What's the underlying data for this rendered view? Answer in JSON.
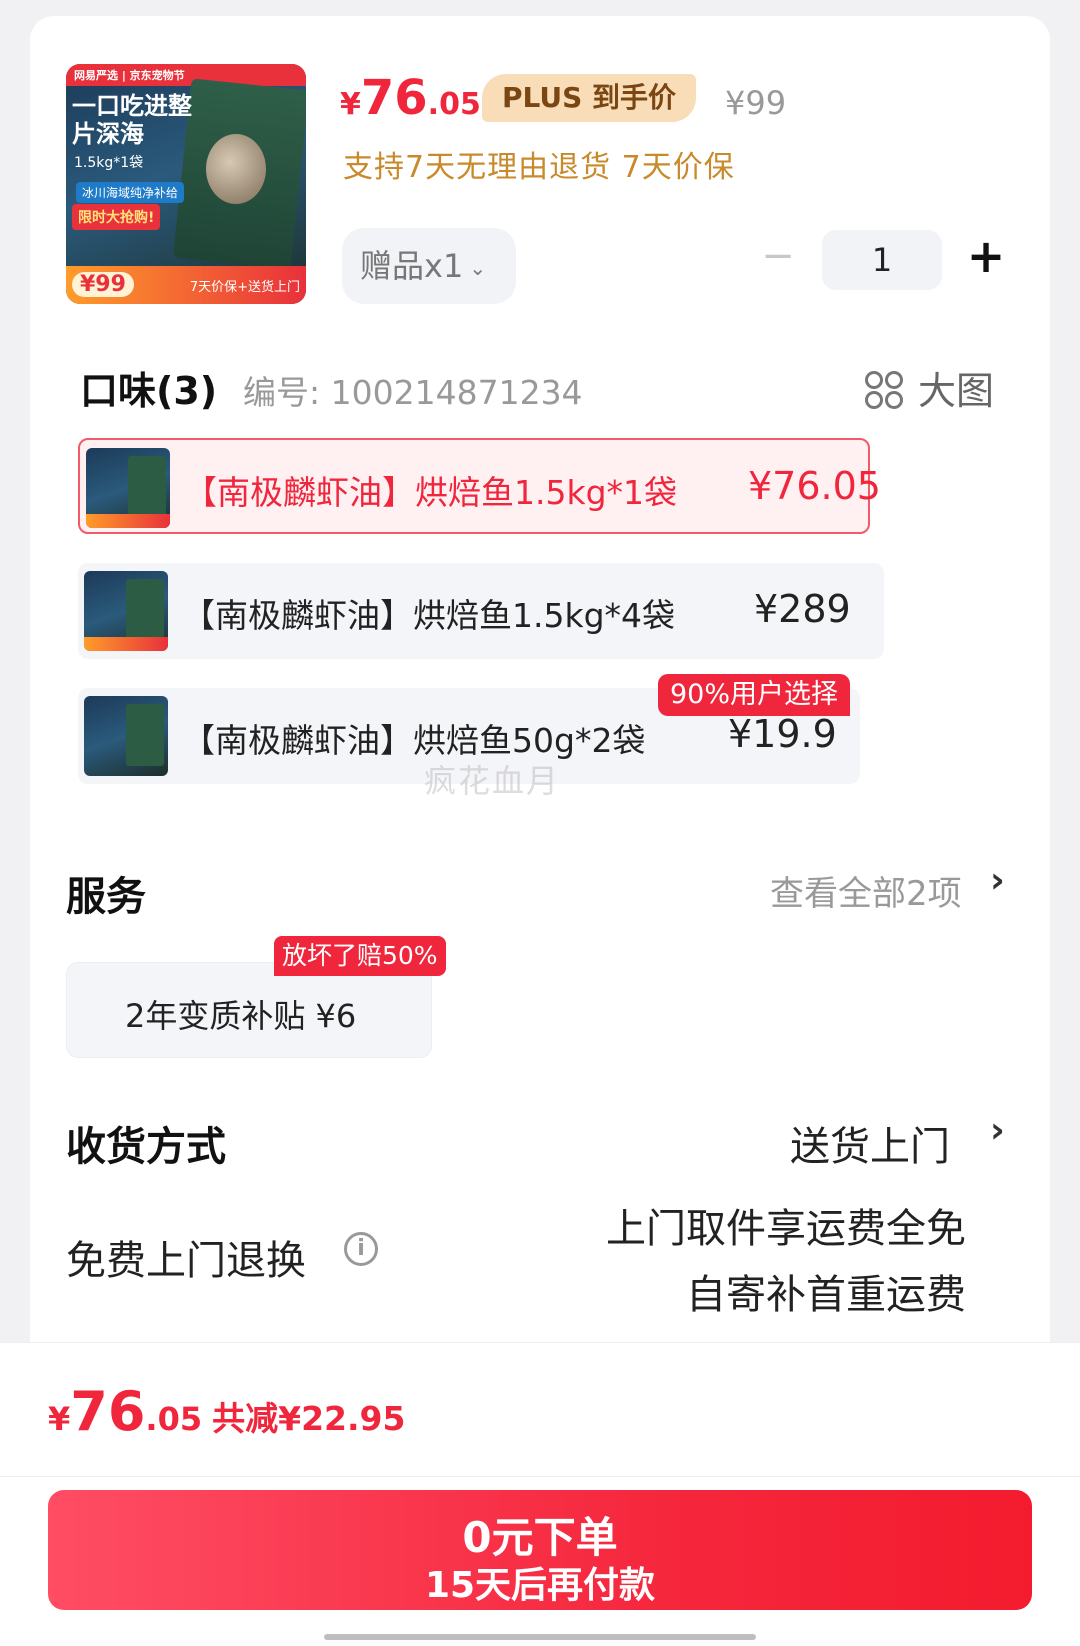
{
  "product": {
    "thumb": {
      "brand_bar": "网易严选 | 京东宠物节",
      "headline": "一口吃进整片深海",
      "spec": "1.5kg*1袋",
      "ribbon": "冰川海域纯净补给",
      "promo": "限时大抢购!",
      "price": "¥99",
      "footer_text": "7天价保+送货上门"
    },
    "price": {
      "yen": "¥",
      "int": "76",
      "dec": ".05"
    },
    "plus_tag": "PLUS 到手价",
    "original_price": "¥99",
    "policy": "支持7天无理由退货  7天价保",
    "gift": "赠品x1",
    "gift_chevron": "⌄",
    "qty": {
      "minus": "−",
      "value": "1",
      "plus": "+"
    }
  },
  "flavor": {
    "title": "口味(3)",
    "item_no": "编号: 100214871234",
    "big_pic": "大图",
    "options": [
      {
        "name": "【南极麟虾油】烘焙鱼1.5kg*1袋",
        "price": "¥76.05",
        "selected": true
      },
      {
        "name": "【南极麟虾油】烘焙鱼1.5kg*4袋",
        "price": "¥289",
        "selected": false
      },
      {
        "name": "【南极麟虾油】烘焙鱼50g*2袋",
        "price": "¥19.9",
        "selected": false,
        "badge": "90%用户选择"
      }
    ],
    "watermark": "疯花血月"
  },
  "service": {
    "title": "服务",
    "view_all": "查看全部2项",
    "arrow": "›",
    "card": {
      "text": "2年变质补贴  ¥6",
      "tag": "放坏了赔50%"
    }
  },
  "shipping": {
    "title": "收货方式",
    "value": "送货上门",
    "arrow": "›"
  },
  "returns": {
    "title": "免费上门退换",
    "info_icon": "i",
    "line1": "上门取件享运费全免",
    "line2": "自寄补首重运费"
  },
  "footer": {
    "price": {
      "yen": "¥",
      "int": "76",
      "dec": ".05"
    },
    "savings": "共减¥22.95",
    "button_line1": "0元下单",
    "button_line2": "15天后再付款"
  },
  "colors": {
    "accent": "#f0263c",
    "gold": "#c88a2a",
    "plus_bg": "#f8ddb8"
  }
}
